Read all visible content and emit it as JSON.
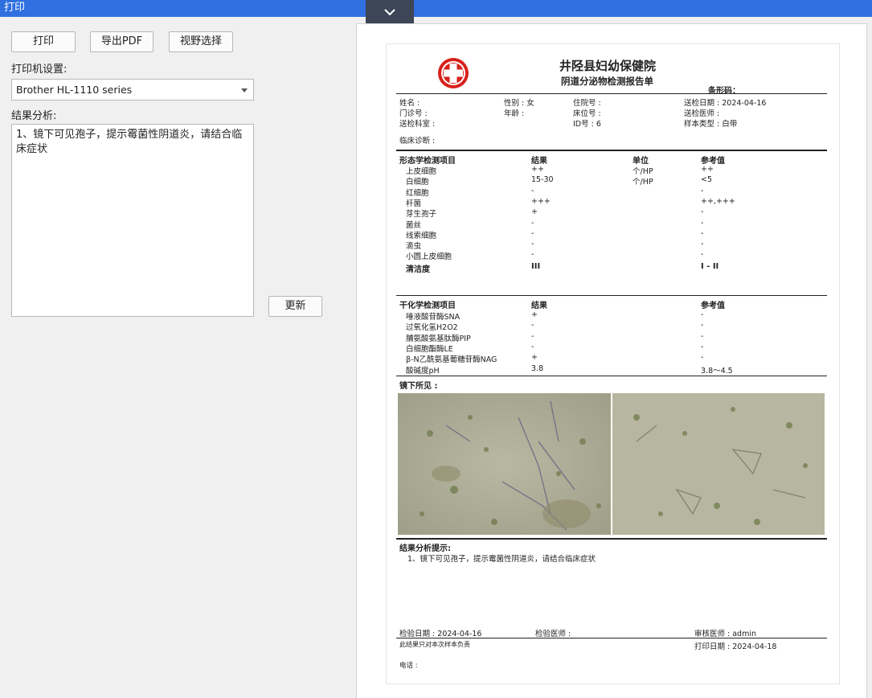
{
  "window": {
    "title": "打印"
  },
  "toolbar": {
    "print_label": "打印",
    "export_pdf_label": "导出PDF",
    "view_select_label": "视野选择"
  },
  "printer": {
    "label": "打印机设置:",
    "selected": "Brother HL-1110 series"
  },
  "analysis": {
    "label": "结果分析:",
    "text": "1、镜下可见孢子，提示霉菌性阴道炎，请结合临床症状",
    "update_label": "更新"
  },
  "report": {
    "hospital": "井陉县妇幼保健院",
    "title": "阴道分泌物检测报告单",
    "barcode_label": "条形码：",
    "patient": {
      "name": "姓名 :",
      "gender": "性别 : 女",
      "inpatient_no": "住院号 :",
      "submit_date": "送检日期 : 2024-04-16",
      "outpatient_no": "门诊号 :",
      "age": "年龄 :",
      "bed_no": "床位号 :",
      "submit_doctor": "送检医师 :",
      "department": "送检科室 :",
      "id_no": "ID号 : 6",
      "sample_type": "样本类型 : 白带",
      "diagnosis": "临床诊断 :"
    },
    "morph": {
      "headers": [
        "形态学检测项目",
        "结果",
        "单位",
        "参考值"
      ],
      "rows": [
        [
          "上皮细胞",
          "++",
          "个/HP",
          "++"
        ],
        [
          "白细胞",
          "15-30",
          "个/HP",
          "<5"
        ],
        [
          "红细胞",
          "-",
          "",
          "-"
        ],
        [
          "杆菌",
          "+++",
          "",
          "++,+++"
        ],
        [
          "芽生孢子",
          "+",
          "",
          "-"
        ],
        [
          "菌丝",
          "-",
          "",
          "-"
        ],
        [
          "线索细胞",
          "-",
          "",
          "-"
        ],
        [
          "滴虫",
          "-",
          "",
          "-"
        ],
        [
          "小圆上皮细胞",
          "-",
          "",
          "-"
        ]
      ],
      "cleanliness": [
        "清洁度",
        "III",
        "",
        "I - II"
      ]
    },
    "biochem": {
      "headers": [
        "干化学检测项目",
        "结果",
        "参考值"
      ],
      "rows": [
        [
          "唾液酸苷酶SNA",
          "+",
          "-"
        ],
        [
          "过氧化氢H2O2",
          "-",
          "-"
        ],
        [
          "脯氨酸氨基肽酶PIP",
          "-",
          "-"
        ],
        [
          "白细胞酯酶LE",
          "-",
          "-"
        ],
        [
          "β-N乙酰氨基葡糖苷酶NAG",
          "+",
          "-"
        ],
        [
          "酸碱度pH",
          "3.8",
          "3.8～4.5"
        ]
      ]
    },
    "microscope_label": "镜下所见 :",
    "analysis_title": "结果分析提示:",
    "analysis_text": "1、镜下可见孢子，提示霉菌性阴道炎，请结合临床症状",
    "footer": {
      "test_date": "检验日期 : 2024-04-16",
      "test_doctor": "检验医师 :",
      "reviewer": "审核医师 : admin",
      "disclaimer": "此结果只对本次样本负责",
      "print_date": "打印日期 : 2024-04-18",
      "phone": "电话 :"
    }
  },
  "colors": {
    "titlebar": "#2f6fe0",
    "logo_red": "#d9201a",
    "collapse_tab": "#3c4657"
  },
  "icons": {
    "collapse": "chevron-down-icon",
    "logo": "red-cross-logo"
  }
}
